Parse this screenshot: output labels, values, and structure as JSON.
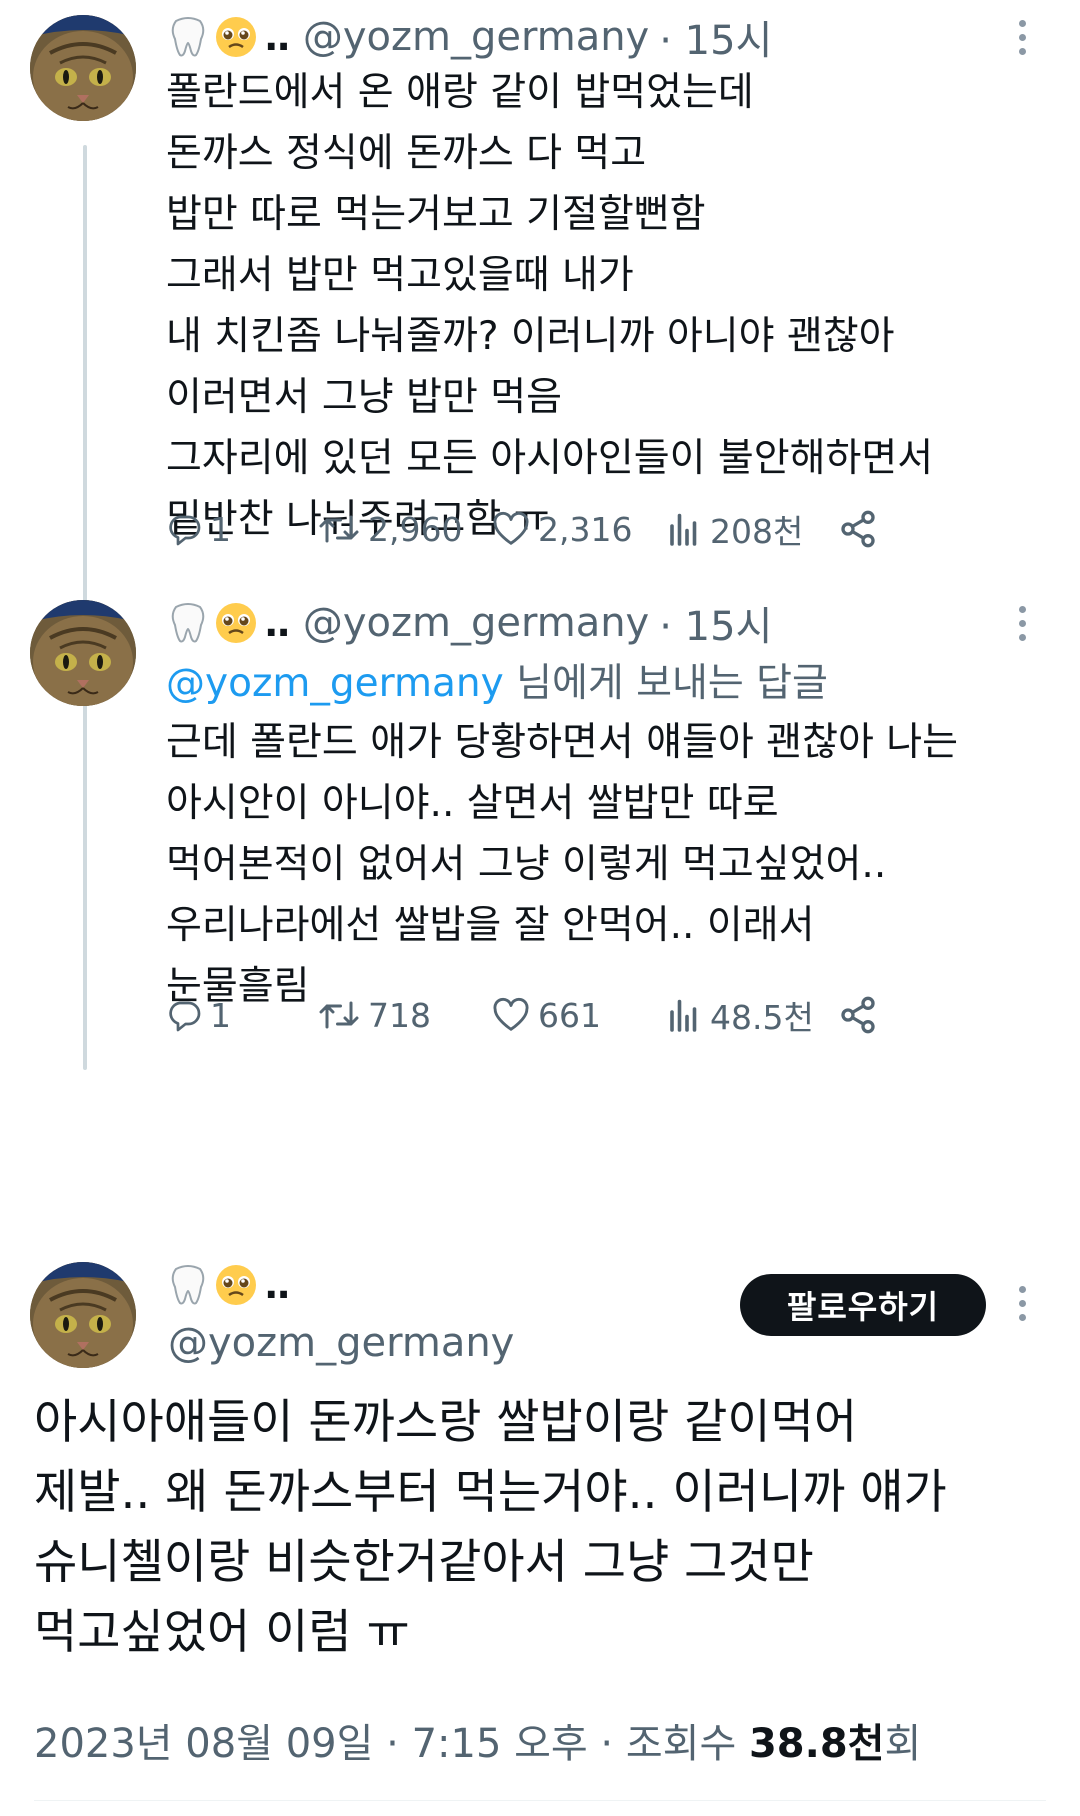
{
  "tweet1": {
    "display_name_dots": "..",
    "handle": "@yozm_germany",
    "time": "· 15시",
    "text": "폴란드에서 온 애랑 같이 밥먹었는데\n돈까스 정식에 돈까스 다 먹고\n밥만 따로 먹는거보고 기절할뻔함\n그래서 밥만 먹고있을때 내가\n내 치킨좀 나눠줄까? 이러니까 아니야 괜찮아\n이러면서 그냥 밥만 먹음\n그자리에 있던 모든 아시아인들이 불안해하면서\n밑반찬 나눠주려고함 ㅠ",
    "replies": "1",
    "retweets": "2,960",
    "likes": "2,316",
    "views": "208천"
  },
  "tweet2": {
    "display_name_dots": "..",
    "handle": "@yozm_germany",
    "time": "· 15시",
    "reply_mention": "@yozm_germany",
    "reply_suffix": " 님에게 보내는 답글",
    "text": "근데 폴란드 애가 당황하면서 얘들아 괜찮아 나는\n아시안이 아니야.. 살면서 쌀밥만 따로\n먹어본적이 없어서 그냥 이렇게 먹고싶었어..\n우리나라에선 쌀밥을 잘 안먹어.. 이래서\n눈물흘림",
    "replies": "1",
    "retweets": "718",
    "likes": "661",
    "views": "48.5천"
  },
  "main_tweet": {
    "display_name_dots": "..",
    "handle": "@yozm_germany",
    "follow_label": "팔로우하기",
    "text": "아시아애들이 돈까스랑 쌀밥이랑 같이먹어\n제발.. 왜 돈까스부터 먹는거야.. 이러니까 얘가\n슈니첼이랑 비슷한거같아서 그냥 그것만\n먹고싶었어 이럼 ㅠ",
    "date": "2023년 08월 09일 · 7:15 오후 · 조회수 ",
    "view_count": "38.8천",
    "view_suffix": "회"
  },
  "colors": {
    "accent": "#1d9bf0",
    "text": "#0f1419",
    "muted": "#536471",
    "thread_line": "#cfd9de"
  },
  "icons": [
    "tooth-icon",
    "pleading-face-icon",
    "reply-icon",
    "retweet-icon",
    "like-icon",
    "views-icon",
    "share-icon",
    "more-icon"
  ]
}
